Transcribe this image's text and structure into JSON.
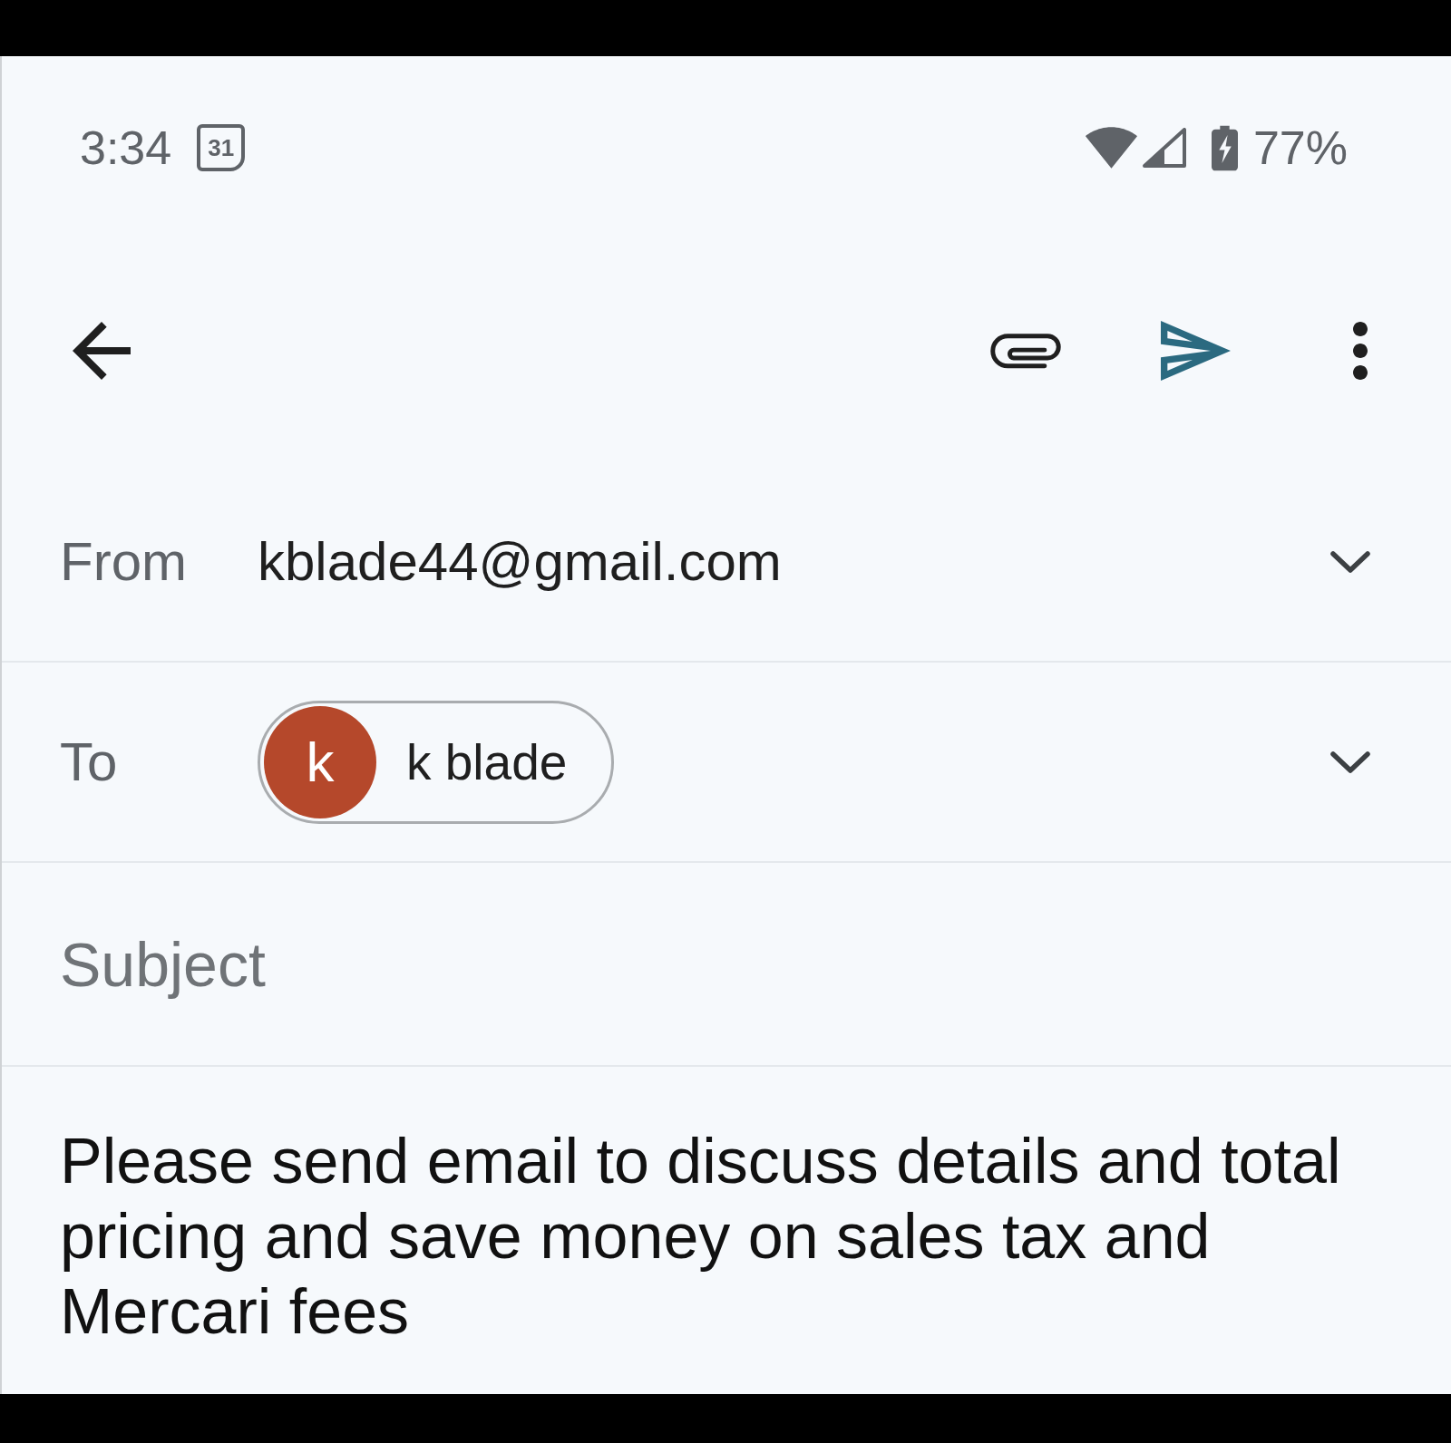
{
  "status_bar": {
    "time": "3:34",
    "calendar_day": "31",
    "battery_percent": "77%"
  },
  "compose": {
    "from": {
      "label": "From",
      "value": "kblade44@gmail.com"
    },
    "to": {
      "label": "To",
      "recipients": [
        {
          "initial": "k",
          "name": "k blade",
          "color": "#b5482b"
        }
      ]
    },
    "subject": {
      "placeholder": "Subject"
    },
    "body": "Please send email to discuss details and total pricing and save money on sales tax and Mercari fees"
  }
}
